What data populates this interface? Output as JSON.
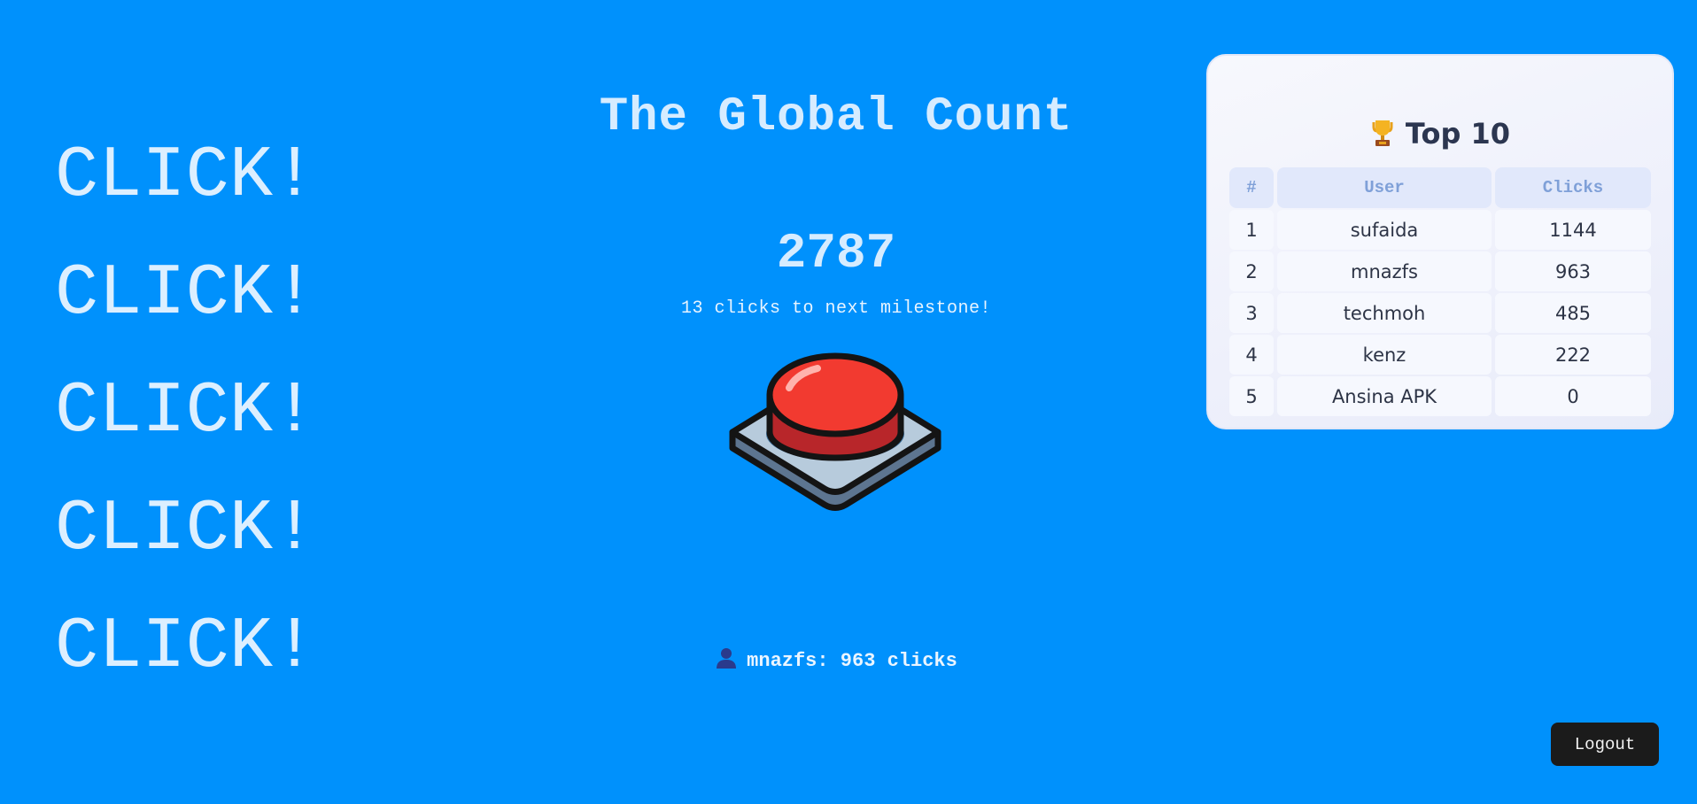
{
  "decor": {
    "click_words": [
      "CLICK!",
      "CLICK!",
      "CLICK!",
      "CLICK!",
      "CLICK!"
    ]
  },
  "main": {
    "title": "The Global Count",
    "count": "2787",
    "milestone_text": "13 clicks to next milestone!",
    "button_icon": "red-push-button-icon"
  },
  "current_user": {
    "icon": "person-icon",
    "text": "mnazfs: 963 clicks"
  },
  "leaderboard": {
    "icon": "trophy-icon",
    "title": "Top 10",
    "columns": [
      "#",
      "User",
      "Clicks"
    ],
    "rows": [
      {
        "rank": "1",
        "user": "sufaida",
        "clicks": "1144"
      },
      {
        "rank": "2",
        "user": "mnazfs",
        "clicks": "963"
      },
      {
        "rank": "3",
        "user": "techmoh",
        "clicks": "485"
      },
      {
        "rank": "4",
        "user": "kenz",
        "clicks": "222"
      },
      {
        "rank": "5",
        "user": "Ansina APK",
        "clicks": "0"
      }
    ]
  },
  "actions": {
    "logout_label": "Logout"
  },
  "colors": {
    "background": "#0091fc",
    "button_red": "#f23a30",
    "logout_bg": "#1b1b1b"
  }
}
